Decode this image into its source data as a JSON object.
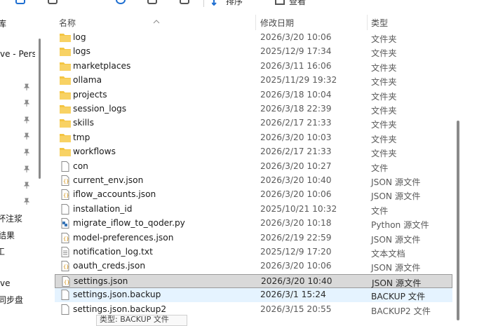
{
  "toolbar": {
    "sort_label": "排序",
    "view_label": "查看"
  },
  "nav": {
    "items": [
      {
        "label": "库"
      },
      {
        "label": "ve - Perso"
      },
      {
        "label": "杯注浆"
      },
      {
        "label": "结果"
      },
      {
        "label": "工"
      },
      {
        "label": "ve"
      },
      {
        "label": "同步盘"
      }
    ]
  },
  "columns": {
    "name": "名称",
    "date": "修改日期",
    "type": "类型"
  },
  "files": [
    {
      "name": "log",
      "date": "2026/3/20 10:06",
      "type": "文件夹",
      "icon": "folder-icon"
    },
    {
      "name": "logs",
      "date": "2025/12/9 17:34",
      "type": "文件夹",
      "icon": "folder-icon"
    },
    {
      "name": "marketplaces",
      "date": "2026/3/11 16:06",
      "type": "文件夹",
      "icon": "folder-icon"
    },
    {
      "name": "ollama",
      "date": "2025/11/29 19:32",
      "type": "文件夹",
      "icon": "folder-icon"
    },
    {
      "name": "projects",
      "date": "2026/3/18 10:04",
      "type": "文件夹",
      "icon": "folder-icon"
    },
    {
      "name": "session_logs",
      "date": "2026/3/18 22:39",
      "type": "文件夹",
      "icon": "folder-icon"
    },
    {
      "name": "skills",
      "date": "2026/2/17 21:33",
      "type": "文件夹",
      "icon": "folder-icon"
    },
    {
      "name": "tmp",
      "date": "2026/3/20 10:03",
      "type": "文件夹",
      "icon": "folder-icon"
    },
    {
      "name": "workflows",
      "date": "2026/2/17 21:33",
      "type": "文件夹",
      "icon": "folder-icon"
    },
    {
      "name": "con",
      "date": "2026/3/20 10:27",
      "type": "文件",
      "icon": "file-icon"
    },
    {
      "name": "current_env.json",
      "date": "2026/3/20 10:40",
      "type": "JSON 源文件",
      "icon": "json-file-icon"
    },
    {
      "name": "iflow_accounts.json",
      "date": "2026/3/20 10:06",
      "type": "JSON 源文件",
      "icon": "json-file-icon"
    },
    {
      "name": "installation_id",
      "date": "2025/10/21 10:32",
      "type": "文件",
      "icon": "file-icon"
    },
    {
      "name": "migrate_iflow_to_qoder.py",
      "date": "2026/3/20 10:18",
      "type": "Python 源文件",
      "icon": "python-file-icon"
    },
    {
      "name": "model-preferences.json",
      "date": "2026/2/19 22:59",
      "type": "JSON 源文件",
      "icon": "json-file-icon"
    },
    {
      "name": "notification_log.txt",
      "date": "2025/12/9 17:20",
      "type": "文本文档",
      "icon": "text-file-icon"
    },
    {
      "name": "oauth_creds.json",
      "date": "2026/3/20 10:06",
      "type": "JSON 源文件",
      "icon": "json-file-icon"
    },
    {
      "name": "settings.json",
      "date": "2026/3/20 10:40",
      "type": "JSON 源文件",
      "icon": "json-file-icon",
      "state": "selected"
    },
    {
      "name": "settings.json.backup",
      "date": "2026/3/1 15:24",
      "type": "BACKUP 文件",
      "icon": "file-icon",
      "state": "hover"
    },
    {
      "name": "settings.json.backup2",
      "date": "2026/3/15 20:55",
      "type": "BACKUP2 文件",
      "icon": "file-icon"
    }
  ],
  "tooltip": {
    "text": "类型: BACKUP 文件"
  },
  "colors": {
    "folder": "#f4c542",
    "accent": "#1f6fd1",
    "selected": "#d9d9d9",
    "hover": "#e5f3ff"
  }
}
